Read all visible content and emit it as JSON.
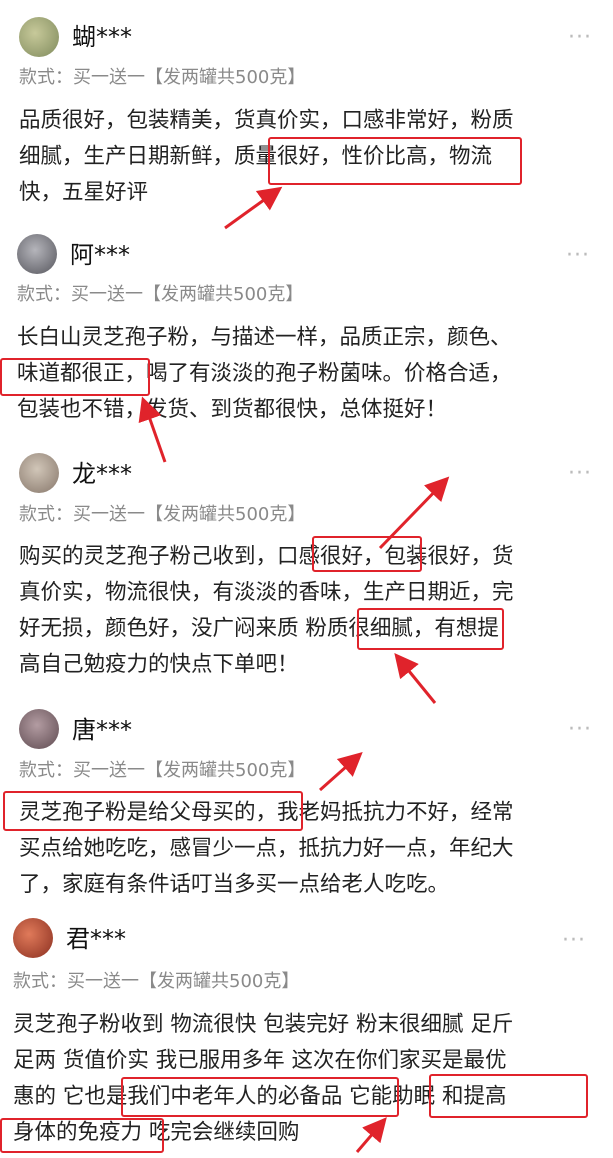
{
  "reviews": [
    {
      "user": "蝴***",
      "more": "···",
      "variant": "款式：买一送一【发两罐共500克】",
      "lines": [
        "品质很好，包装精美，货真价实，口感非常好，粉质",
        "细腻，生产日期新鲜，质量很好，性价比高，物流",
        "快，五星好评"
      ],
      "avatar_color": "#9aa37a"
    },
    {
      "user": "阿***",
      "more": "···",
      "variant": "款式：买一送一【发两罐共500克】",
      "lines": [
        "长白山灵芝孢子粉，与描述一样，品质正宗，颜色、",
        "味道都很正，喝了有淡淡的孢子粉菌味。价格合适，",
        "包装也不错，发货、到货都很快，总体挺好！"
      ],
      "avatar_color": "#8c8c90"
    },
    {
      "user": "龙***",
      "more": "···",
      "variant": "款式：买一送一【发两罐共500克】",
      "lines": [
        "购买的灵芝孢子粉己收到，口感很好，包装很好，货",
        "真价实，物流很快，有淡淡的香味，生产日期近，完",
        "好无损，颜色好，没广闷来质 粉质很细腻，有想提",
        "高自己勉疫力的快点下单吧！"
      ],
      "avatar_color": "#a89a8a"
    },
    {
      "user": "唐***",
      "more": "···",
      "variant": "款式：买一送一【发两罐共500克】",
      "lines": [
        "灵芝孢子粉是给父母买的，我老妈抵抗力不好，经常",
        "买点给她吃吃，感冒少一点，抵抗力好一点，年纪大",
        "了，家庭有条件话叮当多买一点给老人吃吃。"
      ],
      "avatar_color": "#8a7378"
    },
    {
      "user": "君***",
      "more": "···",
      "variant": "款式：买一送一【发两罐共500克】",
      "lines": [
        "灵芝孢子粉收到 物流很快 包装完好 粉末很细腻 足斤",
        "足两 货值价实 我已服用多年 这次在你们家买是最优",
        "惠的 它也是我们中老年人的必备品 它能助眠 和提高",
        "身体的免疫力 吃完会继续回购"
      ],
      "avatar_color": "#b8503a"
    }
  ]
}
